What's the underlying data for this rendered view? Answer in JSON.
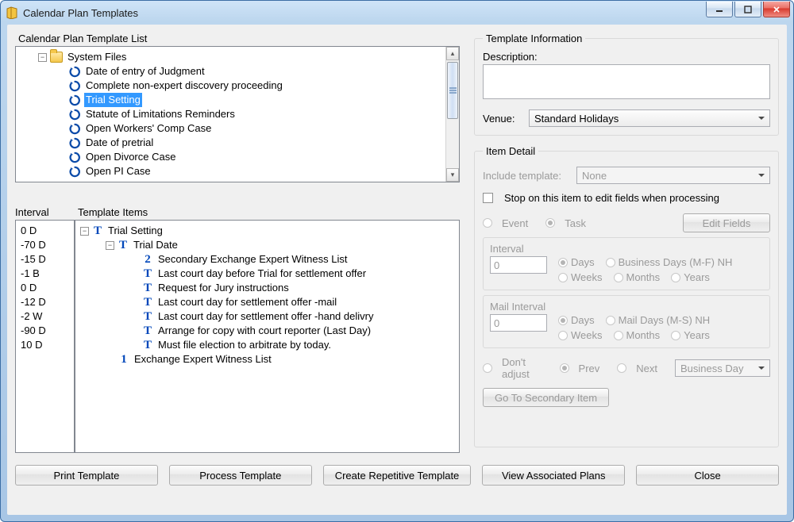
{
  "window": {
    "title": "Calendar Plan Templates"
  },
  "left": {
    "listHeader": "Calendar Plan Template List",
    "root": "System Files",
    "templates": [
      "Date of entry of Judgment",
      "Complete non-expert discovery proceeding",
      "Trial Setting",
      "Statute of Limitations Reminders",
      "Open Workers' Comp Case",
      "Date of pretrial",
      "Open Divorce Case",
      "Open PI Case"
    ],
    "selectedIndex": 2,
    "intervalHeader": "Interval",
    "intervals": [
      "0 D",
      "-70 D",
      "-15 D",
      "-1 B",
      "0 D",
      "-12 D",
      "-2 W",
      "-90 D",
      "10 D"
    ],
    "itemsHeader": "Template Items",
    "items": {
      "root": "Trial Setting",
      "rootChild": {
        "label": "Trial Date",
        "kind": "T",
        "children": [
          {
            "kind": "2",
            "label": "Secondary Exchange Expert Witness List"
          },
          {
            "kind": "T",
            "label": "Last court day before Trial for settlement offer"
          },
          {
            "kind": "T",
            "label": "Request for Jury instructions"
          },
          {
            "kind": "T",
            "label": "Last court day for settlement offer -mail"
          },
          {
            "kind": "T",
            "label": "Last court day for settlement offer -hand delivry"
          },
          {
            "kind": "T",
            "label": "Arrange for copy with court reporter (Last Day)"
          },
          {
            "kind": "T",
            "label": "Must file election to arbitrate by today."
          }
        ]
      },
      "sibling": {
        "kind": "1",
        "label": "Exchange Expert Witness List"
      }
    }
  },
  "templateInfo": {
    "legend": "Template Information",
    "descLabel": "Description:",
    "descValue": "",
    "venueLabel": "Venue:",
    "venueValue": "Standard Holidays"
  },
  "itemDetail": {
    "legend": "Item Detail",
    "includeTemplateLabel": "Include template:",
    "includeTemplateValue": "None",
    "stopLabel": "Stop on this item to edit fields when processing",
    "eventLabel": "Event",
    "taskLabel": "Task",
    "editFieldsLabel": "Edit Fields",
    "interval": {
      "title": "Interval",
      "value": "0",
      "daysLabel": "Days",
      "bdaysLabel": "Business Days (M-F) NH",
      "weeksLabel": "Weeks",
      "monthsLabel": "Months",
      "yearsLabel": "Years"
    },
    "mailInterval": {
      "title": "Mail Interval",
      "value": "0",
      "daysLabel": "Days",
      "mailLabel": "Mail Days (M-S) NH",
      "weeksLabel": "Weeks",
      "monthsLabel": "Months",
      "yearsLabel": "Years"
    },
    "adjust": {
      "dontLabel": "Don't adjust",
      "prevLabel": "Prev",
      "nextLabel": "Next",
      "selectValue": "Business Day"
    },
    "gotoSecondaryLabel": "Go To Secondary Item"
  },
  "buttons": {
    "print": "Print Template",
    "process": "Process Template",
    "createRep": "Create Repetitive Template",
    "viewAssoc": "View Associated Plans",
    "close": "Close"
  }
}
